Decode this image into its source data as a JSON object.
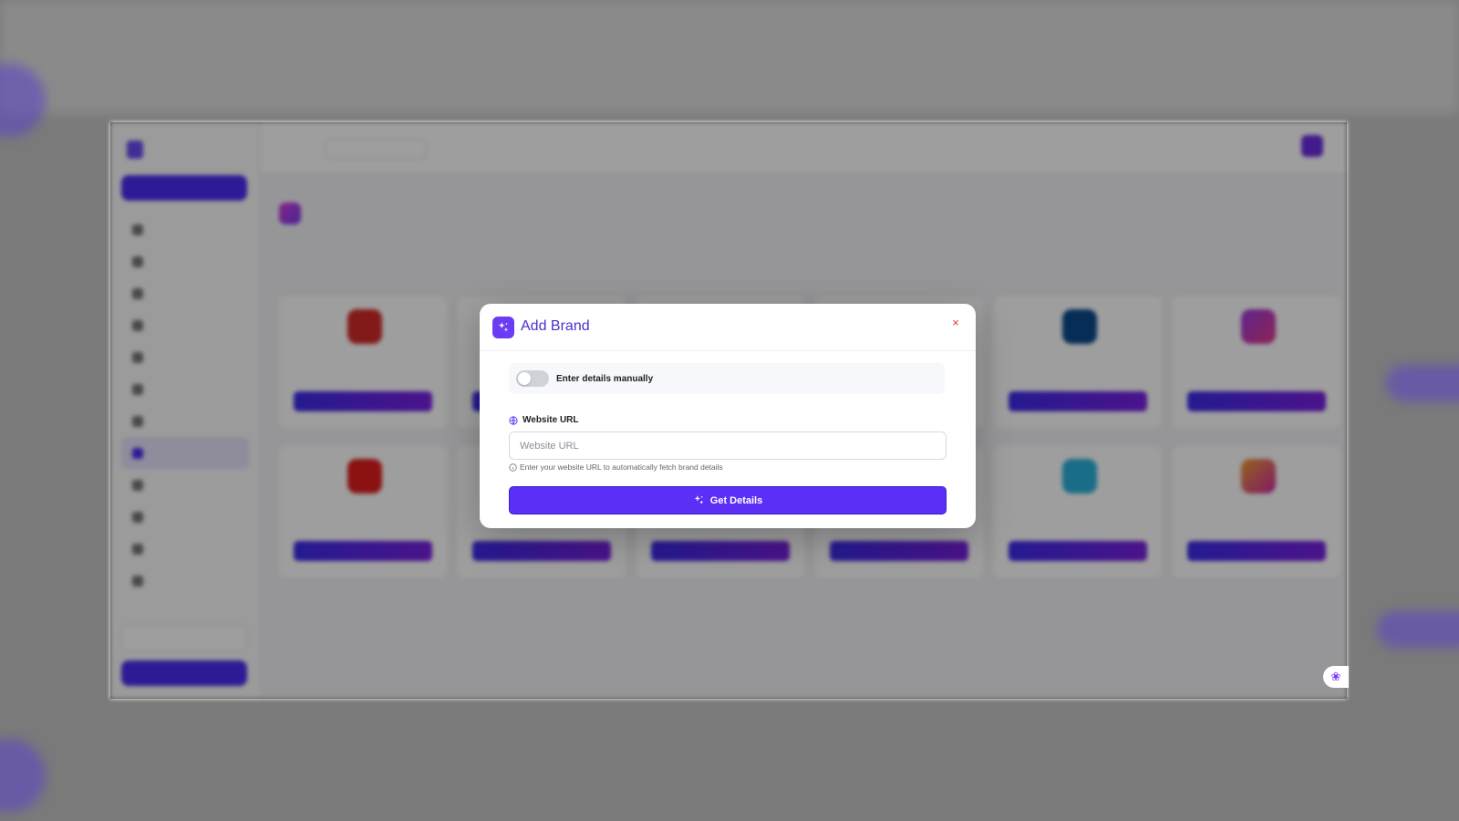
{
  "modal": {
    "title": "Add Brand",
    "toggle_label": "Enter details manually",
    "toggle_on": false,
    "url_label": "Website URL",
    "url_placeholder": "Website URL",
    "url_value": "",
    "url_hint": "Enter your website URL to automatically fetch brand details",
    "submit_label": "Get Details",
    "close_symbol": "×"
  },
  "icons": {
    "header": "sparkles-icon",
    "close": "close-icon",
    "url": "globe-icon",
    "hint": "info-icon",
    "submit": "sparkles-icon",
    "chat": "chat-widget-icon"
  },
  "colors": {
    "accent": "#5b2ff5",
    "title": "#4b2fd0",
    "close": "#d9363e"
  }
}
